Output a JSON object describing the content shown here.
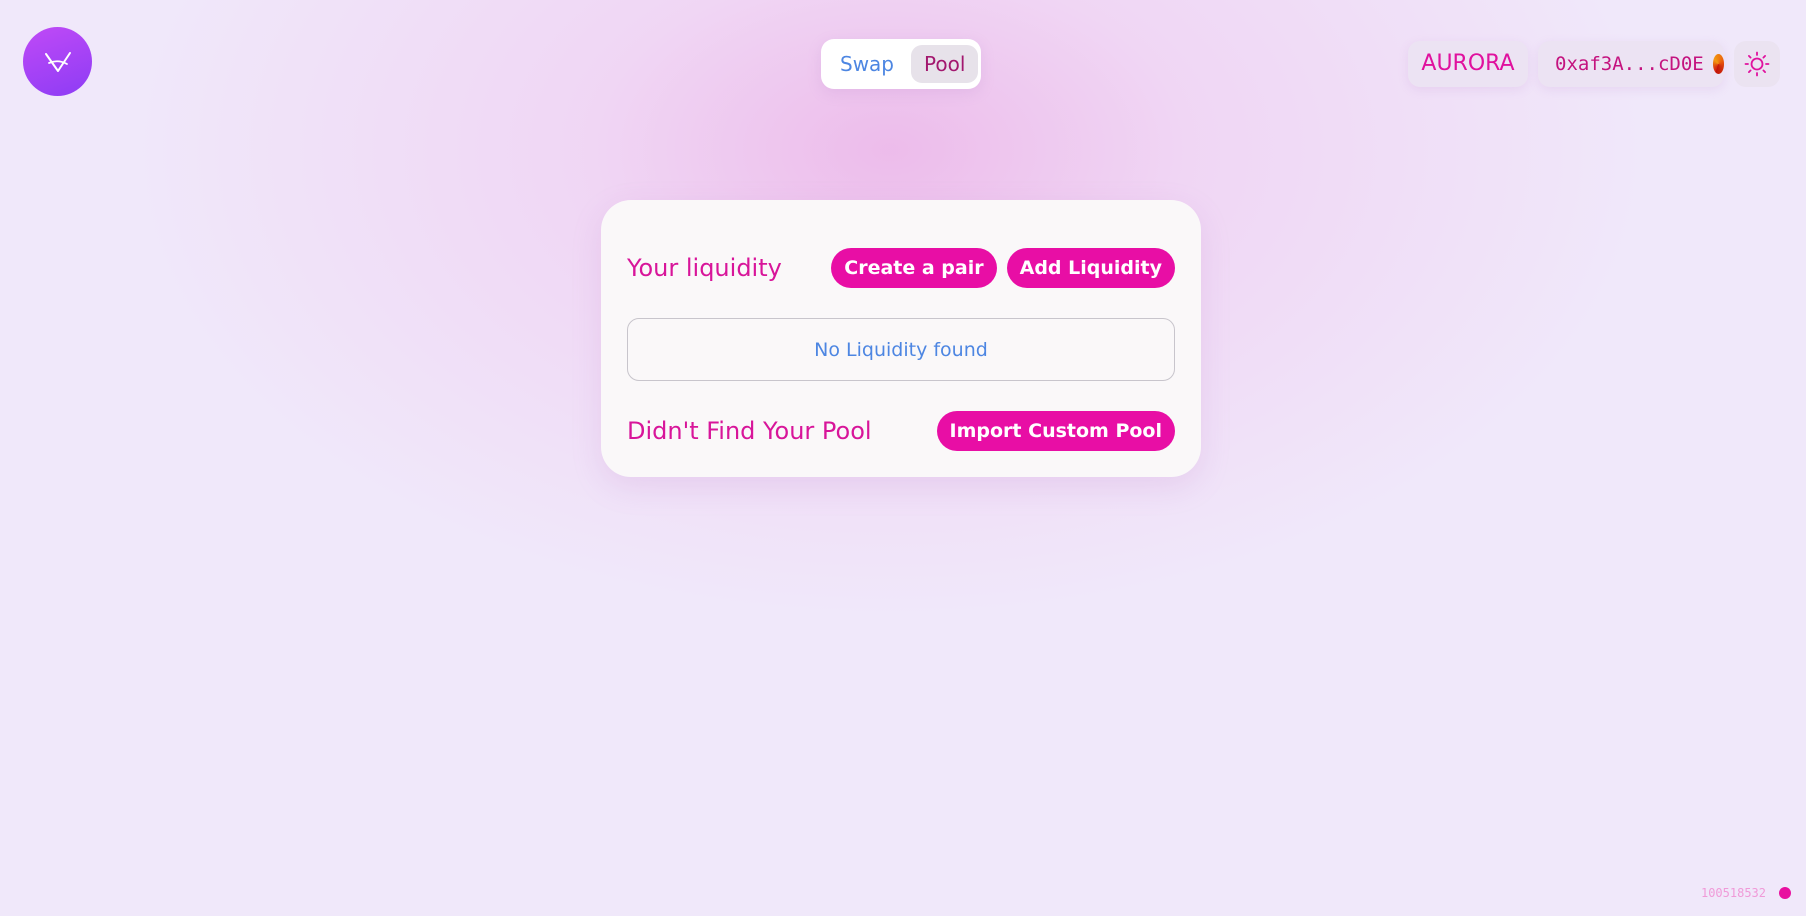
{
  "header": {
    "logo_icon": "v-logo-icon",
    "tabs": [
      {
        "label": "Swap",
        "active": false
      },
      {
        "label": "Pool",
        "active": true
      }
    ],
    "network_label": "AURORA",
    "wallet_address": "0xaf3A...cD0E",
    "wallet_avatar_icon": "wallet-avatar-icon",
    "theme_icon": "sun-icon"
  },
  "pool_card": {
    "title": "Your liquidity",
    "create_pair_label": "Create a pair",
    "add_liquidity_label": "Add Liquidity",
    "empty_message": "No Liquidity found",
    "not_found_label": "Didn't Find Your Pool",
    "import_label": "Import Custom Pool"
  },
  "footer": {
    "block_number": "100518532"
  },
  "colors": {
    "accent_pink": "#e80ea5",
    "link_blue": "#4d86e2",
    "logo_purple": "#a843f5",
    "background": "#f0e8fa"
  }
}
